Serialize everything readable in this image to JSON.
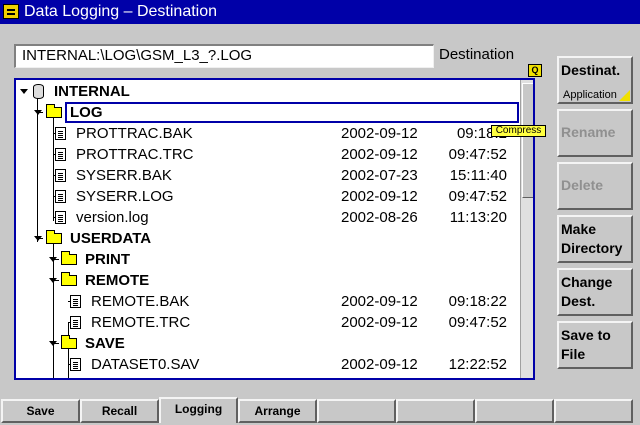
{
  "window": {
    "title": "Data Logging – Destination"
  },
  "path": {
    "value": "INTERNAL:\\LOG\\GSM_L3_?.LOG",
    "label": "Destination",
    "badge": "Q"
  },
  "tree": {
    "rows": [
      {
        "name": "INTERNAL",
        "date": "",
        "time": ""
      },
      {
        "name": "LOG",
        "date": "",
        "time": ""
      },
      {
        "name": "PROTTRAC.BAK",
        "date": "2002-09-12",
        "time": "09:18:2"
      },
      {
        "name": "PROTTRAC.TRC",
        "date": "2002-09-12",
        "time": "09:47:52"
      },
      {
        "name": "SYSERR.BAK",
        "date": "2002-07-23",
        "time": "15:11:40"
      },
      {
        "name": "SYSERR.LOG",
        "date": "2002-09-12",
        "time": "09:47:52"
      },
      {
        "name": "version.log",
        "date": "2002-08-26",
        "time": "11:13:20"
      },
      {
        "name": "USERDATA",
        "date": "",
        "time": ""
      },
      {
        "name": "PRINT",
        "date": "",
        "time": ""
      },
      {
        "name": "REMOTE",
        "date": "",
        "time": ""
      },
      {
        "name": "REMOTE.BAK",
        "date": "2002-09-12",
        "time": "09:18:22"
      },
      {
        "name": "REMOTE.TRC",
        "date": "2002-09-12",
        "time": "09:47:52"
      },
      {
        "name": "SAVE",
        "date": "",
        "time": ""
      },
      {
        "name": "DATASET0.SAV",
        "date": "2002-09-12",
        "time": "12:22:52"
      }
    ],
    "tooltip": "Compress"
  },
  "softkeys": [
    {
      "line1": "Destinat.",
      "line2": "",
      "sub": "Application",
      "enabled": true
    },
    {
      "line1": "Rename",
      "line2": "",
      "sub": "",
      "enabled": false
    },
    {
      "line1": "Delete",
      "line2": "",
      "sub": "",
      "enabled": false
    },
    {
      "line1": "Make",
      "line2": "Directory",
      "sub": "",
      "enabled": true
    },
    {
      "line1": "Change",
      "line2": "Dest.",
      "sub": "",
      "enabled": true
    },
    {
      "line1": "Save to",
      "line2": "File",
      "sub": "",
      "enabled": true
    }
  ],
  "tabs": [
    {
      "label": "Save"
    },
    {
      "label": "Recall"
    },
    {
      "label": "Logging",
      "active": true
    },
    {
      "label": "Arrange"
    },
    {
      "label": ""
    },
    {
      "label": ""
    },
    {
      "label": ""
    },
    {
      "label": ""
    }
  ],
  "colors": {
    "title_bar": "#0000a8",
    "panel_border": "#0000a8",
    "accent": "#f0e000",
    "folder": "#ffff00"
  }
}
